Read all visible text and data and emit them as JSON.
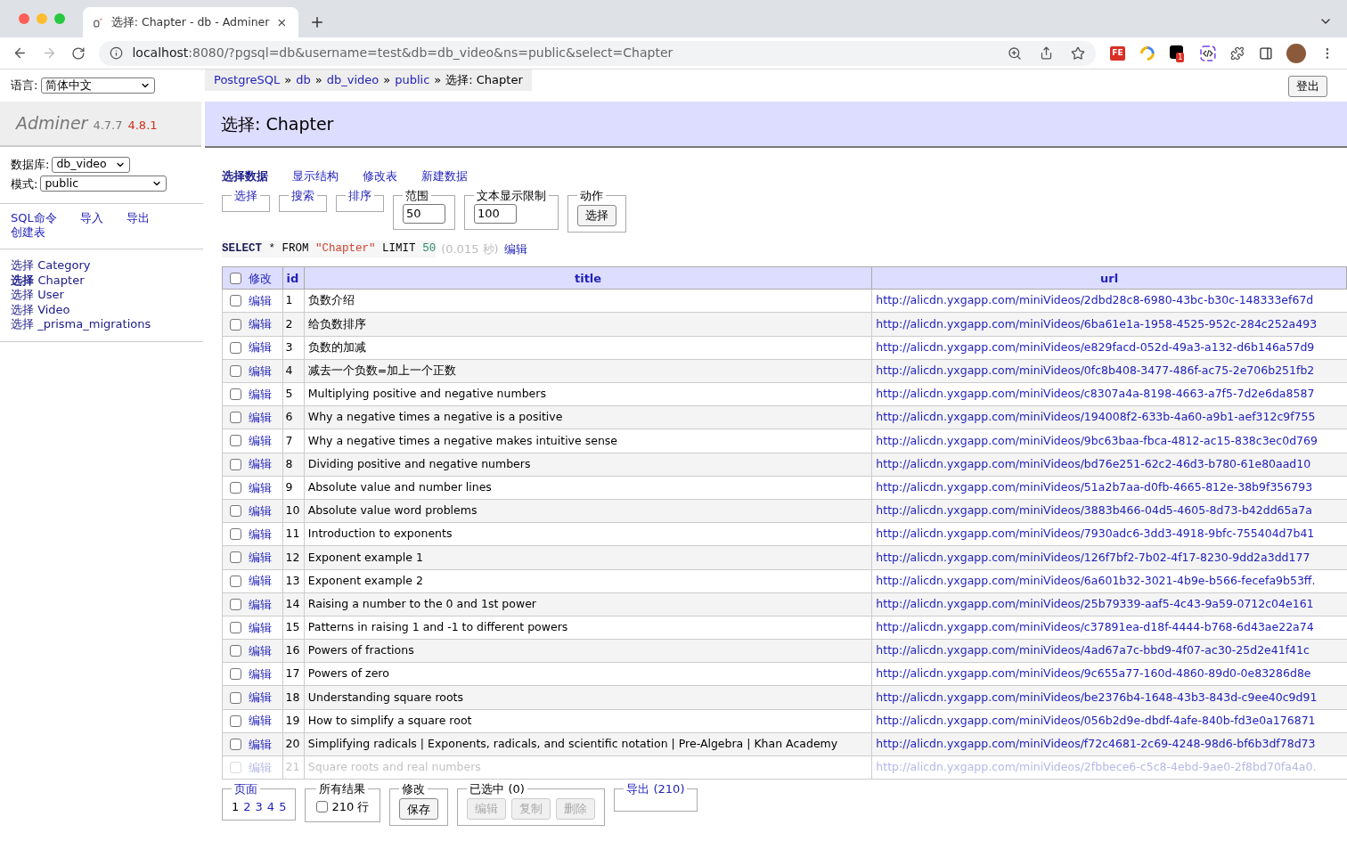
{
  "browser": {
    "tab_title": "选择: Chapter - db - Adminer",
    "url_host": "localhost",
    "url_rest": ":8080/?pgsql=db&username=test&db=db_video&ns=public&select=Chapter",
    "ext_fe": "FE",
    "ext_badge": "1"
  },
  "language": {
    "label": "语言:",
    "value": "简体中文"
  },
  "breadcrumb": [
    {
      "kind": "link",
      "text": "PostgreSQL"
    },
    {
      "kind": "sep",
      "text": "»"
    },
    {
      "kind": "link",
      "text": "db"
    },
    {
      "kind": "sep",
      "text": "»"
    },
    {
      "kind": "link",
      "text": "db_video"
    },
    {
      "kind": "sep",
      "text": "»"
    },
    {
      "kind": "link",
      "text": "public"
    },
    {
      "kind": "sep",
      "text": "»"
    },
    {
      "kind": "current",
      "text": "选择: Chapter"
    }
  ],
  "logout_button": "登出",
  "sidebar": {
    "app_name": "Adminer",
    "version": "4.7.7",
    "new_version": "4.8.1",
    "db_label": "数据库:",
    "db_value": "db_video",
    "schema_label": "模式:",
    "schema_value": "public",
    "links": [
      "SQL命令",
      "导入",
      "导出",
      "创建表"
    ],
    "tables": [
      {
        "prefix": "选择",
        "name": "Category",
        "selected": false
      },
      {
        "prefix": "选择",
        "name": "Chapter",
        "selected": true
      },
      {
        "prefix": "选择",
        "name": "User",
        "selected": false
      },
      {
        "prefix": "选择",
        "name": "Video",
        "selected": false
      },
      {
        "prefix": "选择",
        "name": "_prisma_migrations",
        "selected": false
      }
    ]
  },
  "heading": "选择: Chapter",
  "menu": [
    {
      "label": "选择数据",
      "selected": true
    },
    {
      "label": "显示结构",
      "selected": false
    },
    {
      "label": "修改表",
      "selected": false
    },
    {
      "label": "新建数据",
      "selected": false
    }
  ],
  "fieldsets": [
    {
      "kind": "link",
      "legend": "选择"
    },
    {
      "kind": "link",
      "legend": "搜索"
    },
    {
      "kind": "link",
      "legend": "排序"
    },
    {
      "kind": "input",
      "legend": "范围",
      "value": "50"
    },
    {
      "kind": "input",
      "legend": "文本显示限制",
      "value": "100"
    },
    {
      "kind": "button",
      "legend": "动作",
      "button": "选择"
    }
  ],
  "query": {
    "tokens": [
      {
        "kind": "keyword",
        "text": "SELECT"
      },
      {
        "kind": "plain",
        "text": "* FROM"
      },
      {
        "kind": "string",
        "text": "\"Chapter\""
      },
      {
        "kind": "plain",
        "text": "LIMIT"
      },
      {
        "kind": "number",
        "text": "50"
      }
    ],
    "time": "(0.015 秒)",
    "edit": "编辑"
  },
  "table": {
    "select_all_checked": false,
    "header_edit": "修改",
    "columns": [
      "id",
      "title",
      "url"
    ],
    "rows": [
      {
        "checked": false,
        "dimmed": false,
        "edit": "编辑",
        "id": "1",
        "title": "负数介绍",
        "url": "http://alicdn.yxgapp.com/miniVideos/2dbd28c8-6980-43bc-b30c-148333ef67d"
      },
      {
        "checked": false,
        "dimmed": false,
        "edit": "编辑",
        "id": "2",
        "title": "给负数排序",
        "url": "http://alicdn.yxgapp.com/miniVideos/6ba61e1a-1958-4525-952c-284c252a493"
      },
      {
        "checked": false,
        "dimmed": false,
        "edit": "编辑",
        "id": "3",
        "title": "负数的加减",
        "url": "http://alicdn.yxgapp.com/miniVideos/e829facd-052d-49a3-a132-d6b146a57d9"
      },
      {
        "checked": false,
        "dimmed": false,
        "edit": "编辑",
        "id": "4",
        "title": "减去一个负数=加上一个正数",
        "url": "http://alicdn.yxgapp.com/miniVideos/0fc8b408-3477-486f-ac75-2e706b251fb2"
      },
      {
        "checked": false,
        "dimmed": false,
        "edit": "编辑",
        "id": "5",
        "title": "Multiplying positive and negative numbers",
        "url": "http://alicdn.yxgapp.com/miniVideos/c8307a4a-8198-4663-a7f5-7d2e6da8587"
      },
      {
        "checked": false,
        "dimmed": false,
        "edit": "编辑",
        "id": "6",
        "title": "Why a negative times a negative is a positive",
        "url": "http://alicdn.yxgapp.com/miniVideos/194008f2-633b-4a60-a9b1-aef312c9f755"
      },
      {
        "checked": false,
        "dimmed": false,
        "edit": "编辑",
        "id": "7",
        "title": "Why a negative times a negative makes intuitive sense",
        "url": "http://alicdn.yxgapp.com/miniVideos/9bc63baa-fbca-4812-ac15-838c3ec0d769"
      },
      {
        "checked": false,
        "dimmed": false,
        "edit": "编辑",
        "id": "8",
        "title": "Dividing positive and negative numbers",
        "url": "http://alicdn.yxgapp.com/miniVideos/bd76e251-62c2-46d3-b780-61e80aad10"
      },
      {
        "checked": false,
        "dimmed": false,
        "edit": "编辑",
        "id": "9",
        "title": "Absolute value and number lines",
        "url": "http://alicdn.yxgapp.com/miniVideos/51a2b7aa-d0fb-4665-812e-38b9f356793"
      },
      {
        "checked": false,
        "dimmed": false,
        "edit": "编辑",
        "id": "10",
        "title": "Absolute value word problems",
        "url": "http://alicdn.yxgapp.com/miniVideos/3883b466-04d5-4605-8d73-b42dd65a7a"
      },
      {
        "checked": false,
        "dimmed": false,
        "edit": "编辑",
        "id": "11",
        "title": "Introduction to exponents",
        "url": "http://alicdn.yxgapp.com/miniVideos/7930adc6-3dd3-4918-9bfc-755404d7b41"
      },
      {
        "checked": false,
        "dimmed": false,
        "edit": "编辑",
        "id": "12",
        "title": "Exponent example 1",
        "url": "http://alicdn.yxgapp.com/miniVideos/126f7bf2-7b02-4f17-8230-9dd2a3dd177"
      },
      {
        "checked": false,
        "dimmed": false,
        "edit": "编辑",
        "id": "13",
        "title": "Exponent example 2",
        "url": "http://alicdn.yxgapp.com/miniVideos/6a601b32-3021-4b9e-b566-fecefa9b53ff."
      },
      {
        "checked": false,
        "dimmed": false,
        "edit": "编辑",
        "id": "14",
        "title": "Raising a number to the 0 and 1st power",
        "url": "http://alicdn.yxgapp.com/miniVideos/25b79339-aaf5-4c43-9a59-0712c04e161"
      },
      {
        "checked": false,
        "dimmed": false,
        "edit": "编辑",
        "id": "15",
        "title": "Patterns in raising 1 and -1 to different powers",
        "url": "http://alicdn.yxgapp.com/miniVideos/c37891ea-d18f-4444-b768-6d43ae22a74"
      },
      {
        "checked": false,
        "dimmed": false,
        "edit": "编辑",
        "id": "16",
        "title": "Powers of fractions",
        "url": "http://alicdn.yxgapp.com/miniVideos/4ad67a7c-bbd9-4f07-ac30-25d2e41f41c"
      },
      {
        "checked": false,
        "dimmed": false,
        "edit": "编辑",
        "id": "17",
        "title": "Powers of zero",
        "url": "http://alicdn.yxgapp.com/miniVideos/9c655a77-160d-4860-89d0-0e83286d8e"
      },
      {
        "checked": false,
        "dimmed": false,
        "edit": "编辑",
        "id": "18",
        "title": "Understanding square roots",
        "url": "http://alicdn.yxgapp.com/miniVideos/be2376b4-1648-43b3-843d-c9ee40c9d91"
      },
      {
        "checked": false,
        "dimmed": false,
        "edit": "编辑",
        "id": "19",
        "title": "How to simplify a square root",
        "url": "http://alicdn.yxgapp.com/miniVideos/056b2d9e-dbdf-4afe-840b-fd3e0a176871"
      },
      {
        "checked": false,
        "dimmed": false,
        "edit": "编辑",
        "id": "20",
        "title": "Simplifying radicals | Exponents, radicals, and scientific notation | Pre-Algebra | Khan Academy",
        "url": "http://alicdn.yxgapp.com/miniVideos/f72c4681-2c69-4248-98d6-bf6b3df78d73"
      },
      {
        "checked": false,
        "dimmed": true,
        "edit": "编辑",
        "id": "21",
        "title": "Square roots and real numbers",
        "url": "http://alicdn.yxgapp.com/miniVideos/2fbbece6-c5c8-4ebd-9ae0-2f8bd70fa4a0."
      }
    ]
  },
  "footer": {
    "pages": {
      "legend": "页面",
      "items": [
        {
          "text": "1",
          "selected": true
        },
        {
          "text": "2",
          "selected": false
        },
        {
          "text": "3",
          "selected": false
        },
        {
          "text": "4",
          "selected": false
        },
        {
          "text": "5",
          "selected": false
        }
      ]
    },
    "all_results": {
      "legend": "所有结果",
      "checked": false,
      "text": "210 行"
    },
    "modify": {
      "legend": "修改",
      "button": "保存"
    },
    "selection": {
      "legend": "已选中 (0)",
      "buttons": [
        {
          "label": "编辑",
          "disabled": true
        },
        {
          "label": "复制",
          "disabled": true
        },
        {
          "label": "删除",
          "disabled": true
        }
      ]
    },
    "export": {
      "legend": "导出 (210)"
    }
  }
}
